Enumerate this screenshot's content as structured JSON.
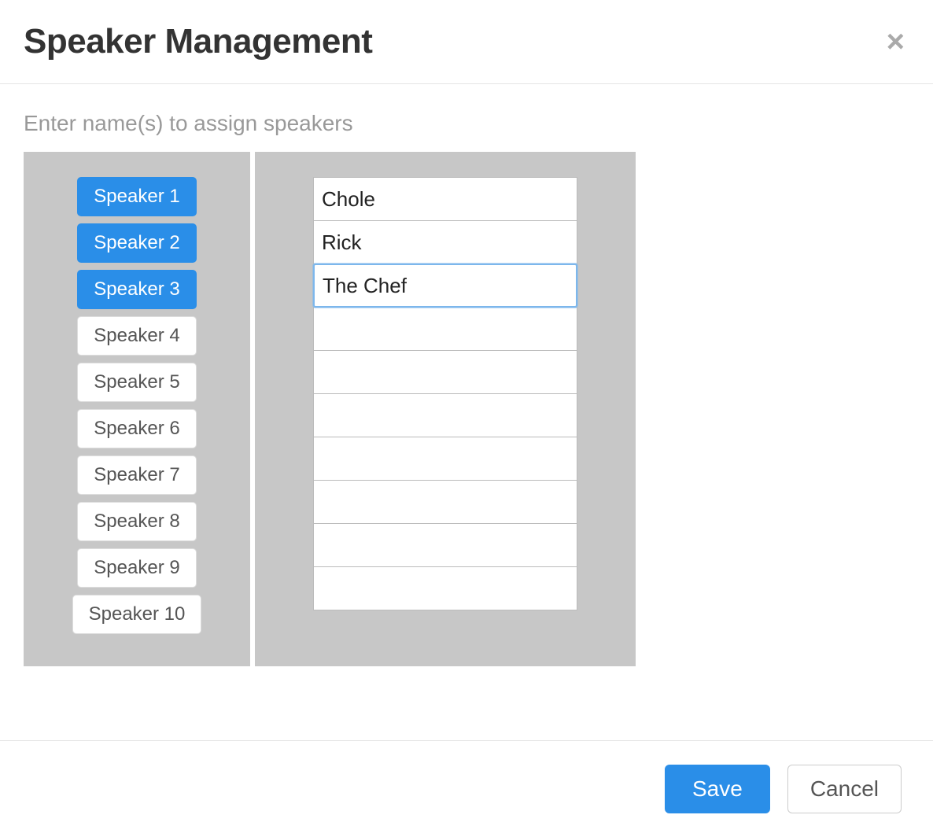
{
  "modal": {
    "title": "Speaker Management",
    "instructions": "Enter name(s) to assign speakers",
    "close_symbol": "×"
  },
  "speakers": [
    {
      "label": "Speaker 1",
      "active": true
    },
    {
      "label": "Speaker 2",
      "active": true
    },
    {
      "label": "Speaker 3",
      "active": true
    },
    {
      "label": "Speaker 4",
      "active": false
    },
    {
      "label": "Speaker 5",
      "active": false
    },
    {
      "label": "Speaker 6",
      "active": false
    },
    {
      "label": "Speaker 7",
      "active": false
    },
    {
      "label": "Speaker 8",
      "active": false
    },
    {
      "label": "Speaker 9",
      "active": false
    },
    {
      "label": "Speaker 10",
      "active": false
    }
  ],
  "names": [
    {
      "value": "Chole",
      "focused": false
    },
    {
      "value": "Rick",
      "focused": false
    },
    {
      "value": "The Chef",
      "focused": true
    },
    {
      "value": "",
      "focused": false
    },
    {
      "value": "",
      "focused": false
    },
    {
      "value": "",
      "focused": false
    },
    {
      "value": "",
      "focused": false
    },
    {
      "value": "",
      "focused": false
    },
    {
      "value": "",
      "focused": false
    },
    {
      "value": "",
      "focused": false
    }
  ],
  "footer": {
    "save_label": "Save",
    "cancel_label": "Cancel"
  }
}
